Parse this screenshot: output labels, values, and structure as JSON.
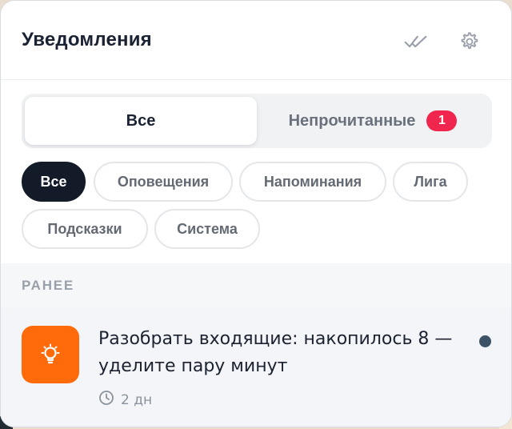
{
  "header": {
    "title": "Уведомления",
    "icons": [
      "double-check-icon",
      "gear-icon"
    ]
  },
  "tabs": [
    {
      "label": "Все",
      "active": true
    },
    {
      "label": "Непрочитанные",
      "active": false,
      "badge": "1"
    }
  ],
  "filters": [
    {
      "label": "Все",
      "active": true
    },
    {
      "label": "Оповещения",
      "active": false
    },
    {
      "label": "Напоминания",
      "active": false
    },
    {
      "label": "Лига",
      "active": false
    },
    {
      "label": "Подсказки",
      "active": false
    },
    {
      "label": "Система",
      "active": false
    }
  ],
  "section_label": "РАНЕЕ",
  "notification": {
    "icon": "lightbulb-icon",
    "text": "Разобрать входящие: накопилось 8 — уделите пару минут",
    "time": "2 дн",
    "unread": true
  },
  "colors": {
    "accent": "#ff6b0a",
    "badge": "#f0264f",
    "active_chip": "#131a28",
    "unread_dot": "#3d5167"
  }
}
